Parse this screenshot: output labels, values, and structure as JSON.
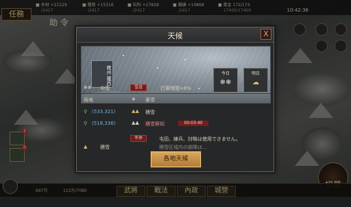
{
  "top_bar": {
    "res_row1": [
      {
        "icon": "wood-icon",
        "label": "木材",
        "value": "+21129"
      },
      {
        "icon": "grain-icon",
        "label": "糧草",
        "value": "+15316"
      },
      {
        "icon": "stone-icon",
        "label": "石料",
        "value": "+27828"
      },
      {
        "icon": "iron-icon",
        "label": "鐵礦",
        "value": "+10868"
      },
      {
        "icon": "gold-icon",
        "label": "黃金",
        "value": "172/174"
      }
    ],
    "res_row2": [
      {
        "value": "/2417"
      },
      {
        "value": "/2417"
      },
      {
        "value": "/2417"
      },
      {
        "value": "/2417"
      },
      {
        "value": "17400/17400"
      }
    ],
    "clock": "10:42:36"
  },
  "hud": {
    "task_label": "任務",
    "left_scroll_label": "助 令",
    "recruit_label": "招募",
    "badge_top": "2",
    "badge_bottom": "0"
  },
  "bottom_bar": {
    "res_left": "697万",
    "res_mid": "113万/7080",
    "tabs": [
      "武將",
      "戰法",
      "內政",
      "城營"
    ]
  },
  "dialog": {
    "title": "天候",
    "close_label": "X",
    "region": [
      "雍州",
      "隴西"
    ],
    "today_label": "今日",
    "tomorrow_label": "明日",
    "today_icon": "❄❄",
    "tomorrow_icon": "☁",
    "current_weather": {
      "icon": "❄❄",
      "label": "中雪",
      "tag": "雪道",
      "effect": "行軍時間+8%"
    },
    "local_label": "局地",
    "local_weather": {
      "icon": "❄",
      "label": "豪雪"
    },
    "locations": [
      {
        "coord": "(533,321)",
        "icon": "mountain-icon",
        "status": "積雪",
        "tag": "",
        "timer": ""
      },
      {
        "coord": "(518,336)",
        "icon": "mountain-snow-icon",
        "status": "積雪察知",
        "tag": "",
        "timer": "00:03:40"
      }
    ],
    "partial_row": {
      "label": "積雪",
      "tag": "冬休",
      "effect": "屯田、練兵、討略は使用できません。",
      "effect2": "積雪区域内の部隊は..."
    },
    "footer_button": "各地天候"
  }
}
